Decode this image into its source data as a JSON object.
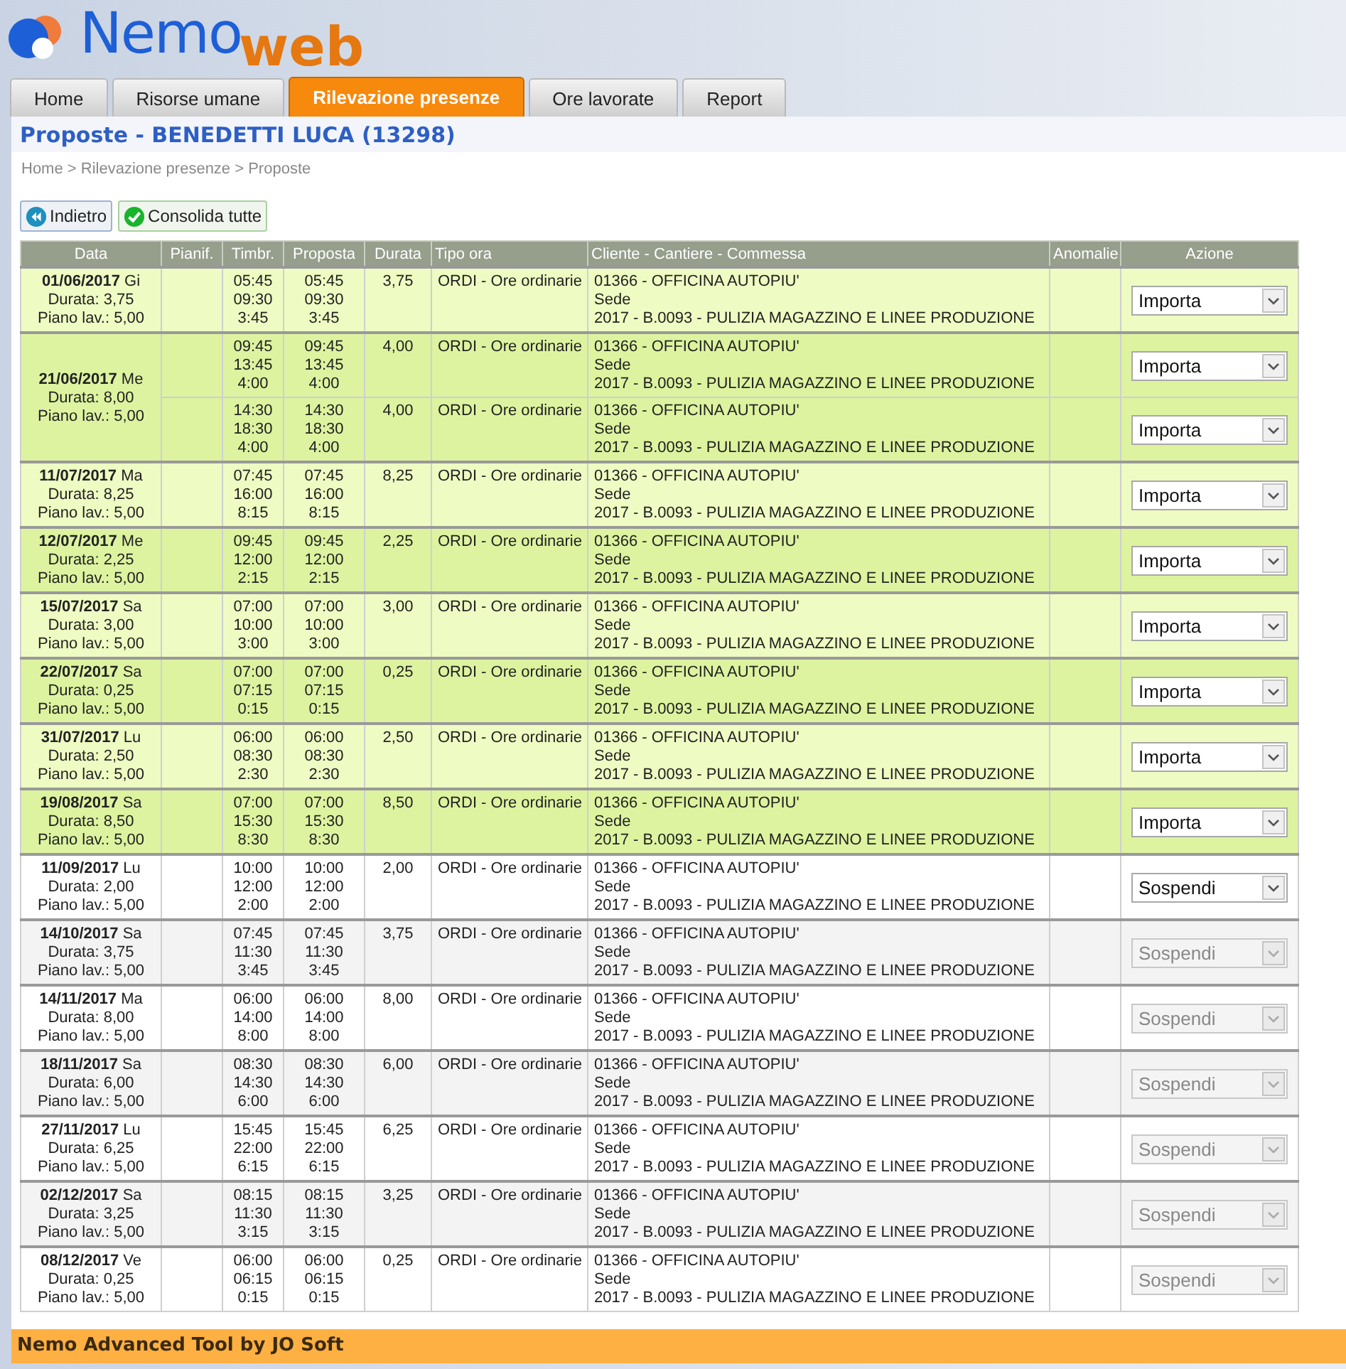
{
  "logo": {
    "first": "Nemo",
    "second": "web"
  },
  "tabs": [
    {
      "label": "Home",
      "selected": false
    },
    {
      "label": "Risorse umane",
      "selected": false
    },
    {
      "label": "Rilevazione presenze",
      "selected": true
    },
    {
      "label": "Ore lavorate",
      "selected": false
    },
    {
      "label": "Report",
      "selected": false
    }
  ],
  "title": "Proposte - BENEDETTI LUCA (13298)",
  "breadcrumb": "Home > Rilevazione presenze > Proposte",
  "buttons": [
    {
      "label": "Indietro",
      "kind": "back"
    },
    {
      "label": "Consolida tutte",
      "kind": "confirm"
    }
  ],
  "table": {
    "columns": [
      "Data",
      "Pianif.",
      "Timbr.",
      "Proposta",
      "Durata",
      "Tipo ora",
      "Cliente - Cantiere - Commessa",
      "Anomalie",
      "Azione"
    ],
    "groups": [
      {
        "date": "**01/06/2017** Gi",
        "durata": "Durata: 3,75",
        "piano": "Piano lav.: 5,00",
        "highlighted": true,
        "entries": [
          {
            "timbr": [
              "05:45",
              "09:30",
              "3:45"
            ],
            "proposta": [
              "05:45",
              "09:30",
              "3:45"
            ],
            "durata": "3,75",
            "tipo": "ORDI - Ore ordinarie",
            "cliente": [
              "01366 - OFFICINA AUTOPIU'",
              "Sede",
              "2017 - B.0093 - PULIZIA MAGAZZINO E LINEE PRODUZIONE"
            ],
            "action": {
              "value": "Importa",
              "disabled": false
            }
          }
        ]
      },
      {
        "date": "**21/06/2017** Me",
        "durata": "Durata: 8,00",
        "piano": "Piano lav.: 5,00",
        "highlighted": true,
        "entries": [
          {
            "timbr": [
              "09:45",
              "13:45",
              "4:00"
            ],
            "proposta": [
              "09:45",
              "13:45",
              "4:00"
            ],
            "durata": "4,00",
            "tipo": "ORDI - Ore ordinarie",
            "cliente": [
              "01366 - OFFICINA AUTOPIU'",
              "Sede",
              "2017 - B.0093 - PULIZIA MAGAZZINO E LINEE PRODUZIONE"
            ],
            "action": {
              "value": "Importa",
              "disabled": false
            }
          },
          {
            "timbr": [
              "14:30",
              "18:30",
              "4:00"
            ],
            "proposta": [
              "14:30",
              "18:30",
              "4:00"
            ],
            "durata": "4,00",
            "tipo": "ORDI - Ore ordinarie",
            "cliente": [
              "01366 - OFFICINA AUTOPIU'",
              "Sede",
              "2017 - B.0093 - PULIZIA MAGAZZINO E LINEE PRODUZIONE"
            ],
            "action": {
              "value": "Importa",
              "disabled": false
            }
          }
        ]
      },
      {
        "date": "**11/07/2017** Ma",
        "durata": "Durata: 8,25",
        "piano": "Piano lav.: 5,00",
        "highlighted": true,
        "entries": [
          {
            "timbr": [
              "07:45",
              "16:00",
              "8:15"
            ],
            "proposta": [
              "07:45",
              "16:00",
              "8:15"
            ],
            "durata": "8,25",
            "tipo": "ORDI - Ore ordinarie",
            "cliente": [
              "01366 - OFFICINA AUTOPIU'",
              "Sede",
              "2017 - B.0093 - PULIZIA MAGAZZINO E LINEE PRODUZIONE"
            ],
            "action": {
              "value": "Importa",
              "disabled": false
            }
          }
        ]
      },
      {
        "date": "**12/07/2017** Me",
        "durata": "Durata: 2,25",
        "piano": "Piano lav.: 5,00",
        "highlighted": true,
        "entries": [
          {
            "timbr": [
              "09:45",
              "12:00",
              "2:15"
            ],
            "proposta": [
              "09:45",
              "12:00",
              "2:15"
            ],
            "durata": "2,25",
            "tipo": "ORDI - Ore ordinarie",
            "cliente": [
              "01366 - OFFICINA AUTOPIU'",
              "Sede",
              "2017 - B.0093 - PULIZIA MAGAZZINO E LINEE PRODUZIONE"
            ],
            "action": {
              "value": "Importa",
              "disabled": false
            }
          }
        ]
      },
      {
        "date": "**15/07/2017** Sa",
        "durata": "Durata: 3,00",
        "piano": "Piano lav.: 5,00",
        "highlighted": true,
        "entries": [
          {
            "timbr": [
              "07:00",
              "10:00",
              "3:00"
            ],
            "proposta": [
              "07:00",
              "10:00",
              "3:00"
            ],
            "durata": "3,00",
            "tipo": "ORDI - Ore ordinarie",
            "cliente": [
              "01366 - OFFICINA AUTOPIU'",
              "Sede",
              "2017 - B.0093 - PULIZIA MAGAZZINO E LINEE PRODUZIONE"
            ],
            "action": {
              "value": "Importa",
              "disabled": false
            }
          }
        ]
      },
      {
        "date": "**22/07/2017** Sa",
        "durata": "Durata: 0,25",
        "piano": "Piano lav.: 5,00",
        "highlighted": true,
        "entries": [
          {
            "timbr": [
              "07:00",
              "07:15",
              "0:15"
            ],
            "proposta": [
              "07:00",
              "07:15",
              "0:15"
            ],
            "durata": "0,25",
            "tipo": "ORDI - Ore ordinarie",
            "cliente": [
              "01366 - OFFICINA AUTOPIU'",
              "Sede",
              "2017 - B.0093 - PULIZIA MAGAZZINO E LINEE PRODUZIONE"
            ],
            "action": {
              "value": "Importa",
              "disabled": false
            }
          }
        ]
      },
      {
        "date": "**31/07/2017** Lu",
        "durata": "Durata: 2,50",
        "piano": "Piano lav.: 5,00",
        "highlighted": true,
        "entries": [
          {
            "timbr": [
              "06:00",
              "08:30",
              "2:30"
            ],
            "proposta": [
              "06:00",
              "08:30",
              "2:30"
            ],
            "durata": "2,50",
            "tipo": "ORDI - Ore ordinarie",
            "cliente": [
              "01366 - OFFICINA AUTOPIU'",
              "Sede",
              "2017 - B.0093 - PULIZIA MAGAZZINO E LINEE PRODUZIONE"
            ],
            "action": {
              "value": "Importa",
              "disabled": false
            }
          }
        ]
      },
      {
        "date": "**19/08/2017** Sa",
        "durata": "Durata: 8,50",
        "piano": "Piano lav.: 5,00",
        "highlighted": true,
        "entries": [
          {
            "timbr": [
              "07:00",
              "15:30",
              "8:30"
            ],
            "proposta": [
              "07:00",
              "15:30",
              "8:30"
            ],
            "durata": "8,50",
            "tipo": "ORDI - Ore ordinarie",
            "cliente": [
              "01366 - OFFICINA AUTOPIU'",
              "Sede",
              "2017 - B.0093 - PULIZIA MAGAZZINO E LINEE PRODUZIONE"
            ],
            "action": {
              "value": "Importa",
              "disabled": false
            }
          }
        ]
      },
      {
        "date": "**11/09/2017** Lu",
        "durata": "Durata: 2,00",
        "piano": "Piano lav.: 5,00",
        "highlighted": false,
        "entries": [
          {
            "timbr": [
              "10:00",
              "12:00",
              "2:00"
            ],
            "proposta": [
              "10:00",
              "12:00",
              "2:00"
            ],
            "durata": "2,00",
            "tipo": "ORDI - Ore ordinarie",
            "cliente": [
              "01366 - OFFICINA AUTOPIU'",
              "Sede",
              "2017 - B.0093 - PULIZIA MAGAZZINO E LINEE PRODUZIONE"
            ],
            "action": {
              "value": "Sospendi",
              "disabled": false
            }
          }
        ]
      },
      {
        "date": "**14/10/2017** Sa",
        "durata": "Durata: 3,75",
        "piano": "Piano lav.: 5,00",
        "highlighted": false,
        "entries": [
          {
            "timbr": [
              "07:45",
              "11:30",
              "3:45"
            ],
            "proposta": [
              "07:45",
              "11:30",
              "3:45"
            ],
            "durata": "3,75",
            "tipo": "ORDI - Ore ordinarie",
            "cliente": [
              "01366 - OFFICINA AUTOPIU'",
              "Sede",
              "2017 - B.0093 - PULIZIA MAGAZZINO E LINEE PRODUZIONE"
            ],
            "action": {
              "value": "Sospendi",
              "disabled": true
            }
          }
        ]
      },
      {
        "date": "**14/11/2017** Ma",
        "durata": "Durata: 8,00",
        "piano": "Piano lav.: 5,00",
        "highlighted": false,
        "entries": [
          {
            "timbr": [
              "06:00",
              "14:00",
              "8:00"
            ],
            "proposta": [
              "06:00",
              "14:00",
              "8:00"
            ],
            "durata": "8,00",
            "tipo": "ORDI - Ore ordinarie",
            "cliente": [
              "01366 - OFFICINA AUTOPIU'",
              "Sede",
              "2017 - B.0093 - PULIZIA MAGAZZINO E LINEE PRODUZIONE"
            ],
            "action": {
              "value": "Sospendi",
              "disabled": true
            }
          }
        ]
      },
      {
        "date": "**18/11/2017** Sa",
        "durata": "Durata: 6,00",
        "piano": "Piano lav.: 5,00",
        "highlighted": false,
        "entries": [
          {
            "timbr": [
              "08:30",
              "14:30",
              "6:00"
            ],
            "proposta": [
              "08:30",
              "14:30",
              "6:00"
            ],
            "durata": "6,00",
            "tipo": "ORDI - Ore ordinarie",
            "cliente": [
              "01366 - OFFICINA AUTOPIU'",
              "Sede",
              "2017 - B.0093 - PULIZIA MAGAZZINO E LINEE PRODUZIONE"
            ],
            "action": {
              "value": "Sospendi",
              "disabled": true
            }
          }
        ]
      },
      {
        "date": "**27/11/2017** Lu",
        "durata": "Durata: 6,25",
        "piano": "Piano lav.: 5,00",
        "highlighted": false,
        "entries": [
          {
            "timbr": [
              "15:45",
              "22:00",
              "6:15"
            ],
            "proposta": [
              "15:45",
              "22:00",
              "6:15"
            ],
            "durata": "6,25",
            "tipo": "ORDI - Ore ordinarie",
            "cliente": [
              "01366 - OFFICINA AUTOPIU'",
              "Sede",
              "2017 - B.0093 - PULIZIA MAGAZZINO E LINEE PRODUZIONE"
            ],
            "action": {
              "value": "Sospendi",
              "disabled": true
            }
          }
        ]
      },
      {
        "date": "**02/12/2017** Sa",
        "durata": "Durata: 3,25",
        "piano": "Piano lav.: 5,00",
        "highlighted": false,
        "entries": [
          {
            "timbr": [
              "08:15",
              "11:30",
              "3:15"
            ],
            "proposta": [
              "08:15",
              "11:30",
              "3:15"
            ],
            "durata": "3,25",
            "tipo": "ORDI - Ore ordinarie",
            "cliente": [
              "01366 - OFFICINA AUTOPIU'",
              "Sede",
              "2017 - B.0093 - PULIZIA MAGAZZINO E LINEE PRODUZIONE"
            ],
            "action": {
              "value": "Sospendi",
              "disabled": true
            }
          }
        ]
      },
      {
        "date": "**08/12/2017** Ve",
        "durata": "Durata: 0,25",
        "piano": "Piano lav.: 5,00",
        "highlighted": false,
        "entries": [
          {
            "timbr": [
              "06:00",
              "06:15",
              "0:15"
            ],
            "proposta": [
              "06:00",
              "06:15",
              "0:15"
            ],
            "durata": "0,25",
            "tipo": "ORDI - Ore ordinarie",
            "cliente": [
              "01366 - OFFICINA AUTOPIU'",
              "Sede",
              "2017 - B.0093 - PULIZIA MAGAZZINO E LINEE PRODUZIONE"
            ],
            "action": {
              "value": "Sospendi",
              "disabled": true
            }
          }
        ]
      }
    ]
  },
  "footer": "Nemo Advanced Tool by JO Soft"
}
